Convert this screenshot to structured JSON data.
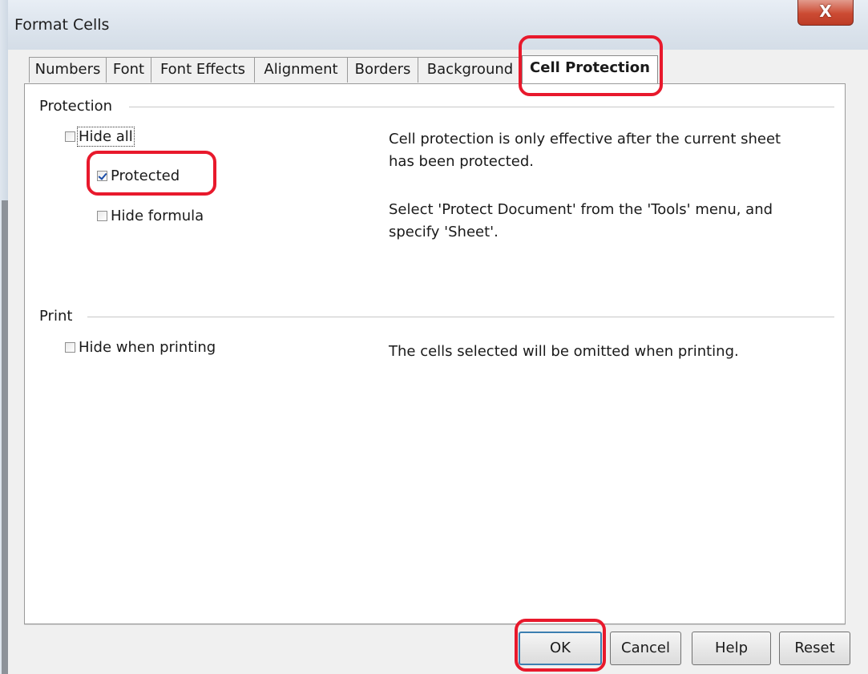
{
  "window": {
    "title": "Format Cells",
    "close_glyph": "X"
  },
  "tabs": [
    {
      "label": "Numbers"
    },
    {
      "label": "Font"
    },
    {
      "label": "Font Effects"
    },
    {
      "label": "Alignment"
    },
    {
      "label": "Borders"
    },
    {
      "label": "Background"
    },
    {
      "label": "Cell Protection",
      "active": true
    }
  ],
  "protection": {
    "group_label": "Protection",
    "hide_all": {
      "label": "Hide all",
      "checked": false
    },
    "protected": {
      "label": "Protected",
      "checked": true
    },
    "hide_formula": {
      "label": "Hide formula",
      "checked": false
    },
    "info_1a": "Cell protection is only effective after the current sheet",
    "info_1b": "has been protected.",
    "info_2a": "Select 'Protect Document' from the 'Tools' menu, and",
    "info_2b": "specify 'Sheet'."
  },
  "print": {
    "group_label": "Print",
    "hide_when_printing": {
      "label": "Hide when printing",
      "checked": false
    },
    "info": "The cells selected will be omitted when printing."
  },
  "buttons": {
    "ok": "OK",
    "cancel": "Cancel",
    "help": "Help",
    "reset": "Reset"
  },
  "colors": {
    "highlight": "#e8192c",
    "close_button": "#cc4b33",
    "default_button_border": "#3c7fb1"
  }
}
